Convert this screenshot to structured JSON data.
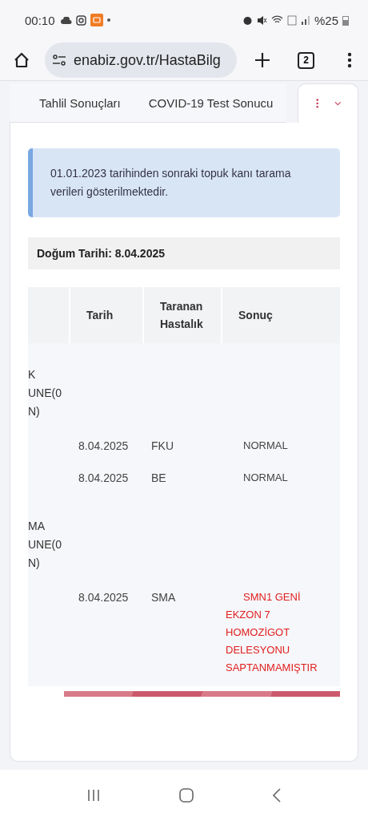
{
  "status_bar": {
    "time": "00:10",
    "battery": "%25"
  },
  "browser": {
    "url": "enabiz.gov.tr/HastaBilg",
    "tab_count": "2"
  },
  "tabs": [
    {
      "label": "Tahlil Sonuçları",
      "selected": false
    },
    {
      "label": "COVID-19 Test Sonucu",
      "selected": false
    },
    {
      "kind": "more",
      "selected": true
    }
  ],
  "info": "01.01.2023 tarihinden sonraki topuk kanı tarama verileri gösterilmektedir.",
  "birth_date": "Doğum Tarihi: 8.04.2025",
  "table": {
    "columns": [
      "Tarih",
      "Taranan Hastalık",
      "Sonuç"
    ],
    "rows": [
      {
        "kind": "group",
        "lines": [
          "K",
          "UNE(0",
          "N)"
        ]
      },
      {
        "kind": "data",
        "date": "8.04.2025",
        "disease": "FKU",
        "result": "NORMAL",
        "alert": false
      },
      {
        "kind": "data",
        "date": "8.04.2025",
        "disease": "BE",
        "result": "NORMAL",
        "alert": false
      },
      {
        "kind": "group",
        "lines": [
          "MA",
          "UNE(0",
          "N)"
        ]
      },
      {
        "kind": "data",
        "date": "8.04.2025",
        "disease": "SMA",
        "result": "SMN1 GENİ EKZON 7 HOMOZİGOT DELESYONU SAPTANMAMIŞTIR",
        "alert": true
      }
    ]
  }
}
